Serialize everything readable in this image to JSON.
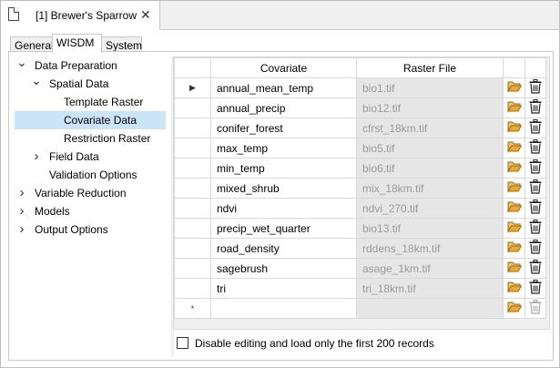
{
  "document_tab": {
    "title": "[1] Brewer's Sparrow",
    "close_symbol": "✕"
  },
  "sub_tabs": [
    "General",
    "WISDM",
    "System"
  ],
  "tree": {
    "items": [
      {
        "label": "Data Preparation",
        "indent": 0,
        "chevron": "down"
      },
      {
        "label": "Spatial Data",
        "indent": 1,
        "chevron": "down"
      },
      {
        "label": "Template Raster",
        "indent": 2,
        "chevron": ""
      },
      {
        "label": "Covariate Data",
        "indent": 2,
        "chevron": "",
        "selected": true
      },
      {
        "label": "Restriction Raster",
        "indent": 2,
        "chevron": ""
      },
      {
        "label": "Field Data",
        "indent": 1,
        "chevron": "right"
      },
      {
        "label": "Validation Options",
        "indent": 1,
        "chevron": ""
      },
      {
        "label": "Variable Reduction",
        "indent": 0,
        "chevron": "right"
      },
      {
        "label": "Models",
        "indent": 0,
        "chevron": "right"
      },
      {
        "label": "Output Options",
        "indent": 0,
        "chevron": "right"
      }
    ]
  },
  "grid": {
    "columns": [
      "Covariate",
      "Raster File"
    ],
    "current_row_marker": "▶",
    "new_row_marker": "*",
    "rows": [
      {
        "covariate": "annual_mean_temp",
        "raster": "bio1.tif"
      },
      {
        "covariate": "annual_precip",
        "raster": "bio12.tif"
      },
      {
        "covariate": "conifer_forest",
        "raster": "cfrst_18km.tif"
      },
      {
        "covariate": "max_temp",
        "raster": "bio5.tif"
      },
      {
        "covariate": "min_temp",
        "raster": "bio6.tif"
      },
      {
        "covariate": "mixed_shrub",
        "raster": "mix_18km.tif"
      },
      {
        "covariate": "ndvi",
        "raster": "ndvi_270.tif"
      },
      {
        "covariate": "precip_wet_quarter",
        "raster": "bio13.tif"
      },
      {
        "covariate": "road_density",
        "raster": "rddens_18km.tif"
      },
      {
        "covariate": "sagebrush",
        "raster": "asage_1km.tif"
      },
      {
        "covariate": "tri",
        "raster": "tri_18km.tif"
      },
      {
        "covariate": "",
        "raster": ""
      }
    ]
  },
  "footer": {
    "checkbox_label": "Disable editing and load only the first 200 records",
    "checked": false
  },
  "colors": {
    "selection": "#cce4f7",
    "folder": "#e8a93a",
    "readonly_cell": "#e6e6e6"
  }
}
